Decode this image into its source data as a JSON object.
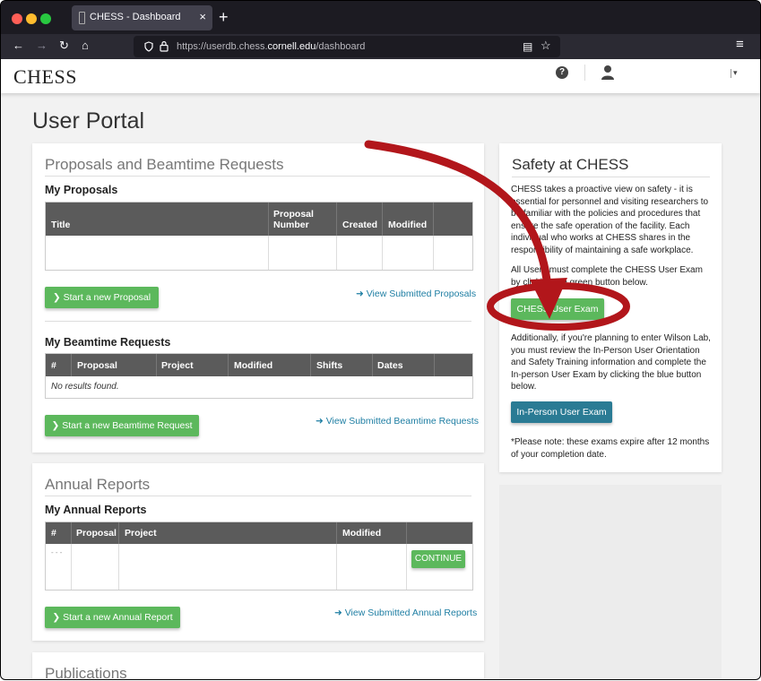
{
  "browser": {
    "tab_title": "CHESS - Dashboard",
    "tab_close": "×",
    "new_tab": "+",
    "url_prefix": "https://userdb.chess.",
    "url_domain": "cornell.edu",
    "url_path": "/dashboard",
    "nav": {
      "back": "←",
      "forward": "→",
      "reload": "↻",
      "home": "⌂",
      "menu": "≡",
      "reader": "▤",
      "bookmark": "☆"
    }
  },
  "site": {
    "logo": "CHESS",
    "help_glyph": "?",
    "caret": "▾"
  },
  "page": {
    "title": "User Portal"
  },
  "proposals_panel": {
    "title": "Proposals and Beamtime Requests",
    "my_proposals": {
      "heading": "My Proposals",
      "columns": [
        "Title",
        "Proposal Number",
        "Created",
        "Modified"
      ],
      "columns_display": {
        "title": "Title",
        "proposal_number_1": "Proposal",
        "proposal_number_2": "Number",
        "created": "Created",
        "modified": "Modified"
      },
      "new_button": "Start a new Proposal",
      "view_link": "View Submitted Proposals"
    },
    "my_beamtime": {
      "heading": "My Beamtime Requests",
      "columns": [
        "#",
        "Proposal",
        "Project",
        "Modified",
        "Shifts",
        "Dates"
      ],
      "no_results": "No results found.",
      "new_button": "Start a new Beamtime Request",
      "view_link": "View Submitted Beamtime Requests"
    }
  },
  "annual_panel": {
    "title": "Annual Reports",
    "heading": "My Annual Reports",
    "columns": [
      "#",
      "Proposal",
      "Project",
      "Modified"
    ],
    "row_placeholder": "- - -",
    "continue_button": "CONTINUE",
    "new_button": "Start a new Annual Report",
    "view_link": "View Submitted Annual Reports"
  },
  "publications_panel": {
    "title": "Publications"
  },
  "safety_panel": {
    "title": "Safety at CHESS",
    "para1": "CHESS takes a proactive view on safety - it is essential for personnel and visiting researchers to be familiar with the policies and procedures that ensure the safe operation of the facility. Each individual who works at CHESS shares in the responsibility of maintaining a safe workplace.",
    "para2": "All Users must complete the CHESS User Exam by clicking the green button below.",
    "exam_button": "CHESS User Exam",
    "para3": "Additionally, if you're planning to enter Wilson Lab, you must review the In-Person User Orientation and Safety Training information and complete the In-person User Exam by clicking the blue button below.",
    "inperson_button": "In-Person User Exam",
    "note": "*Please note: these exams expire after 12 months of your completion date."
  },
  "annotation": {
    "color": "#b2161b"
  }
}
